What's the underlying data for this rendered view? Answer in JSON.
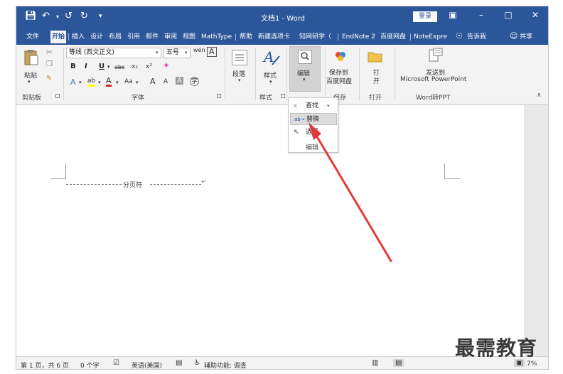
{
  "window": {
    "doc_title": "文档1 - Word",
    "login_label": "登录",
    "quick_access": [
      "save-icon",
      "undo-icon",
      "redo-icon",
      "refresh-icon",
      "customize-icon"
    ],
    "controls": [
      "ribbon-display-icon",
      "minimize-icon",
      "maximize-icon",
      "close-icon"
    ]
  },
  "tabs": [
    {
      "label": "文件"
    },
    {
      "label": "开始",
      "active": true
    },
    {
      "label": "插入"
    },
    {
      "label": "设计"
    },
    {
      "label": "布局"
    },
    {
      "label": "引用"
    },
    {
      "label": "邮件"
    },
    {
      "label": "审阅"
    },
    {
      "label": "视图"
    },
    {
      "label": "MathType"
    },
    {
      "label": "帮助"
    },
    {
      "label": "新建选项卡"
    },
    {
      "label": "知网研学（"
    },
    {
      "label": "EndNote 2"
    },
    {
      "label": "百度网盘"
    },
    {
      "label": "NoteExpre"
    }
  ],
  "tell_me": "告诉我",
  "share": "共享",
  "ribbon": {
    "clipboard": {
      "paste_label": "粘贴",
      "group_label": "剪贴板"
    },
    "font": {
      "font_name": "等线 (西文正文)",
      "font_size": "五号",
      "wen_glyph": "wén",
      "boxA": "A",
      "bold": "B",
      "italic": "I",
      "underline": "U",
      "strike": "abc",
      "sub": "x₂",
      "sup": "x²",
      "effects": "A",
      "highlight": "ab",
      "color": "A",
      "case": "Aa",
      "grow": "A",
      "shrink": "A",
      "shade": "A",
      "enclose": "字",
      "group_label": "字体"
    },
    "paragraph": {
      "label": "段落"
    },
    "styles": {
      "label": "样式",
      "group_label": "样式"
    },
    "editing": {
      "label": "编辑"
    },
    "save": {
      "line1": "保存到",
      "line2": "百度网盘",
      "group_label": "保存"
    },
    "open": {
      "line1": "打",
      "line2": "开",
      "group_label": "打开"
    },
    "ppt": {
      "line1": "发送到",
      "line2": "Microsoft PowerPoint",
      "group_label": "Word转PPT"
    }
  },
  "dropdown": {
    "items": [
      {
        "label": "查找",
        "icon": "search-icon"
      },
      {
        "label": "替换",
        "icon": "replace-icon",
        "highlighted": true
      },
      {
        "label": "选择",
        "icon": "select-icon"
      }
    ],
    "footer": "编辑"
  },
  "document": {
    "page_break_label": "分页符",
    "pilcrow": "↵"
  },
  "status": {
    "page": "第 1 页，共 6 页",
    "words": "0 个字",
    "language": "英语(美国)",
    "accessibility": "辅助功能: 调查",
    "zoom": "7%"
  },
  "watermark": "最需教育",
  "colors": {
    "title_bar": "#2b579a",
    "arrow": "#e23a3a"
  }
}
